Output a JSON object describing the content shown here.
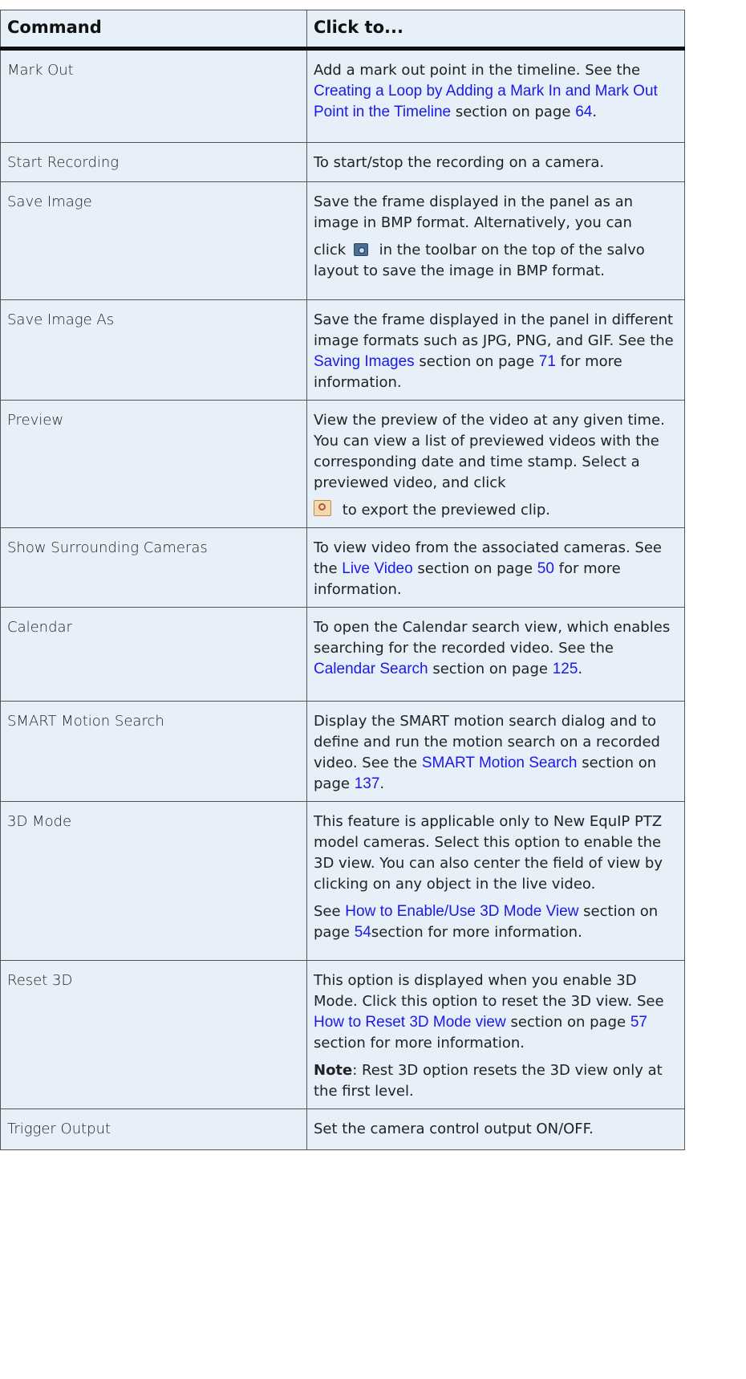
{
  "table": {
    "headers": [
      "Command",
      "Click to..."
    ],
    "rows": [
      {
        "command": "Mark Out",
        "parts": [
          {
            "t": "Add a mark out point in the timeline. See the "
          },
          {
            "t": "Creating a Loop by Adding a Mark In and Mark Out Point in the Timeline",
            "link": true
          },
          {
            "t": "  section on page "
          },
          {
            "t": "64",
            "link": true
          },
          {
            "t": "."
          }
        ]
      },
      {
        "command": "Start Recording",
        "parts": [
          {
            "t": "To start/stop the recording on a camera."
          }
        ]
      },
      {
        "command": "Save Image",
        "parts": [
          {
            "t": "Save the frame displayed in the panel as an image in BMP format. Alternatively, you can"
          },
          {
            "br": true
          },
          {
            "t": "click "
          },
          {
            "icon": "camera-snapshot-icon"
          },
          {
            "t": " in the toolbar on the top of the salvo layout to save the image in BMP format."
          }
        ]
      },
      {
        "command": "Save Image As",
        "parts": [
          {
            "t": "Save the frame displayed in the panel in different image formats such as JPG, PNG, and GIF. See the "
          },
          {
            "t": "Saving Images",
            "link": true
          },
          {
            "t": "  section on page "
          },
          {
            "t": "71",
            "link": true
          },
          {
            "t": " for more information."
          }
        ]
      },
      {
        "command": "Preview",
        "parts": [
          {
            "t": "View the preview of the video at any given time. You can view a list of previewed videos with the corresponding date and time stamp. Select a previewed video, and click"
          },
          {
            "br": true
          },
          {
            "icon": "export-clip-icon"
          },
          {
            "t": " to export the previewed clip."
          }
        ]
      },
      {
        "command": "Show Surrounding Cameras",
        "parts": [
          {
            "t": "To view video from the associated cameras. See the "
          },
          {
            "t": "Live Video",
            "link": true
          },
          {
            "t": "  section on page "
          },
          {
            "t": "50",
            "link": true
          },
          {
            "t": " for more information."
          }
        ]
      },
      {
        "command": "Calendar",
        "parts": [
          {
            "t": "To open the Calendar search view, which enables searching for the recorded video. See the "
          },
          {
            "t": "Calendar Search",
            "link": true
          },
          {
            "t": "  section on page "
          },
          {
            "t": "125",
            "link": true
          },
          {
            "t": "."
          }
        ]
      },
      {
        "command": "SMART Motion Search",
        "parts": [
          {
            "t": "Display the SMART motion search dialog and to define and run the motion search on a recorded video. See the "
          },
          {
            "t": "SMART Motion Search",
            "link": true
          },
          {
            "t": "  section on page "
          },
          {
            "t": "137",
            "link": true
          },
          {
            "t": "."
          }
        ]
      },
      {
        "command": "3D Mode",
        "parts": [
          {
            "t": "This feature is applicable only to New EquIP PTZ model cameras. Select this option to enable the 3D view. You can also center the field of view by clicking on any object in the live video."
          },
          {
            "br": true
          },
          {
            "t": "See "
          },
          {
            "t": "How to Enable/Use 3D Mode View",
            "link": true
          },
          {
            "t": " section on page "
          },
          {
            "t": "54",
            "link": true
          },
          {
            "t": "section for more information."
          }
        ]
      },
      {
        "command": "Reset 3D",
        "parts": [
          {
            "t": "This option is displayed when you enable 3D Mode. Click this option to reset the 3D view. See "
          },
          {
            "t": "How to Reset 3D Mode view",
            "link": true
          },
          {
            "t": " section on page "
          },
          {
            "t": "57",
            "link": true
          },
          {
            "t": " section for more information."
          },
          {
            "br": true
          },
          {
            "t": "Note",
            "bold": true
          },
          {
            "t": ": Rest 3D option resets the 3D view only at the first level."
          }
        ]
      },
      {
        "command": "Trigger Output",
        "parts": [
          {
            "t": "Set the camera control output ON/OFF."
          }
        ]
      }
    ]
  }
}
